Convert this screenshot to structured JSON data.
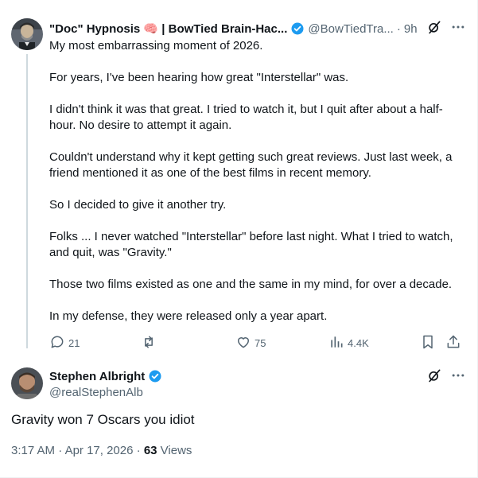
{
  "parent": {
    "display_name": "\"Doc\" Hypnosis 🧠 | BowTied Brain-Hac...",
    "handle": "@BowTiedTra...",
    "dot": "·",
    "time": "9h",
    "paragraphs": [
      "My most embarrassing moment of 2026.",
      "For years, I've been hearing how great \"Interstellar\" was.",
      "I didn't think it was that great. I tried to watch it, but I quit after about a half-hour. No desire to attempt it again.",
      "Couldn't understand why it kept getting such great reviews. Just last week, a friend mentioned it as one of the best films in recent memory.",
      "So I decided to give it another try.",
      "Folks ... I never watched \"Interstellar\" before last night. What I tried to watch, and quit, was \"Gravity.\"",
      "Those two films existed as one and the same in my mind, for over a decade.",
      "In my defense, they were released only a year apart."
    ],
    "stats": {
      "replies": "21",
      "reposts": "",
      "likes": "75",
      "views": "4.4K"
    }
  },
  "reply": {
    "display_name": "Stephen Albright",
    "handle": "@realStephenAlb",
    "text": "Gravity won 7 Oscars you idiot",
    "time": "3:17 AM",
    "sep": "·",
    "date": "Apr 17, 2026",
    "views_count": "63",
    "views_label": "Views"
  },
  "colors": {
    "text": "#0f1419",
    "secondary": "#536471",
    "verified": "#1d9bf0",
    "border": "#eff3f4",
    "thread_line": "#cfd9de"
  },
  "icons": [
    "grok-icon",
    "more-icon",
    "reply-icon",
    "repost-icon",
    "like-icon",
    "views-icon",
    "bookmark-icon",
    "share-icon",
    "verified-badge-icon"
  ]
}
